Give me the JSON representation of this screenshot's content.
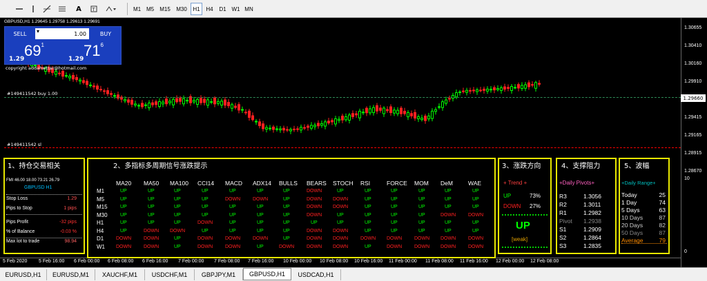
{
  "toolbar": {
    "tools": [
      "line-icon",
      "vertical-line-icon",
      "crosshair-icon",
      "trendline-icon",
      "text-icon",
      "label-icon",
      "arrows-icon"
    ],
    "text_tool": "A",
    "timeframes": [
      "M1",
      "M5",
      "M15",
      "M30",
      "H1",
      "H4",
      "D1",
      "W1",
      "MN"
    ],
    "active_timeframe": "H1"
  },
  "chart": {
    "symbol_line": "GBPUSD,H1  1.29645 1.29758 1.29613 1.29691",
    "copyright": "copyright  addahwttar@hotmail.com",
    "order_line_label": "#149411542 buy 1.00",
    "sl_line_label": "#149411542 sl",
    "current_price": "1.29691",
    "y_ticks": [
      "1.30655",
      "1.30410",
      "1.30160",
      "1.29910",
      "1.29660",
      "1.29415",
      "1.29165",
      "1.28915",
      "1.28670",
      "10",
      "0"
    ],
    "x_ticks": [
      "5 Feb 2020",
      "5 Feb 16:00",
      "6 Feb 00:00",
      "6 Feb 08:00",
      "6 Feb 16:00",
      "7 Feb 00:00",
      "7 Feb 08:00",
      "7 Feb 16:00",
      "10 Feb 00:00",
      "10 Feb 08:00",
      "10 Feb 16:00",
      "11 Feb 00:00",
      "11 Feb 08:00",
      "11 Feb 16:00",
      "12 Feb 00:00",
      "12 Feb 08:00"
    ],
    "colors": {
      "up": "#00ff00",
      "down": "#ff2020",
      "order_line": "#2e8b57",
      "sl_line": "#ff0000"
    }
  },
  "trade_panel": {
    "sell_label": "SELL",
    "buy_label": "BUY",
    "lot": "1.00",
    "sell_price_prefix": "1.29",
    "sell_price_big": "69",
    "sell_price_sup": "1",
    "buy_price_prefix": "1.29",
    "buy_price_big": "71",
    "buy_price_sup": "6"
  },
  "panel1": {
    "title": "1、持仓交易相关",
    "header": "FMI 46.00 18.00    73.21 26.79",
    "symbol": "GBPUSD  H1",
    "rows": [
      {
        "label": "Stop Loss",
        "value": "1.29"
      },
      {
        "label": "Pips to Stop",
        "value": "1 pips"
      },
      {
        "label": "Pips Profit",
        "value": "-32 pips"
      },
      {
        "label": "% of Balance",
        "value": "-0.03 %"
      },
      {
        "label": "Max lot to trade",
        "value": "98.94"
      }
    ]
  },
  "panel2": {
    "title": "2、多指标多周期信号涨跌提示",
    "columns": [
      "MA20",
      "MA50",
      "MA100",
      "CCI14",
      "MACD",
      "ADX14",
      "BULLS",
      "BEARS",
      "STOCH",
      "RSI",
      "FORCE",
      "MOM",
      "DeM",
      "WAE"
    ],
    "rows": [
      {
        "tf": "M1",
        "cells": [
          "UP",
          "UP",
          "UP",
          "UP",
          "UP",
          "UP",
          "UP",
          "DOWN",
          "UP",
          "UP",
          "UP",
          "UP",
          "UP",
          "UP"
        ]
      },
      {
        "tf": "M5",
        "cells": [
          "UP",
          "UP",
          "UP",
          "UP",
          "DOWN",
          "DOWN",
          "UP",
          "DOWN",
          "DOWN",
          "UP",
          "UP",
          "UP",
          "UP",
          "UP"
        ]
      },
      {
        "tf": "M15",
        "cells": [
          "UP",
          "UP",
          "UP",
          "UP",
          "UP",
          "UP",
          "UP",
          "DOWN",
          "DOWN",
          "UP",
          "UP",
          "UP",
          "UP",
          "UP"
        ]
      },
      {
        "tf": "M30",
        "cells": [
          "UP",
          "UP",
          "UP",
          "UP",
          "UP",
          "UP",
          "UP",
          "DOWN",
          "UP",
          "UP",
          "UP",
          "UP",
          "DOWN",
          "DOWN"
        ]
      },
      {
        "tf": "H1",
        "cells": [
          "UP",
          "UP",
          "UP",
          "DOWN",
          "UP",
          "UP",
          "UP",
          "UP",
          "UP",
          "UP",
          "UP",
          "UP",
          "UP",
          "UP"
        ]
      },
      {
        "tf": "H4",
        "cells": [
          "UP",
          "DOWN",
          "DOWN",
          "UP",
          "UP",
          "UP",
          "UP",
          "DOWN",
          "DOWN",
          "UP",
          "UP",
          "UP",
          "UP",
          "UP"
        ]
      },
      {
        "tf": "D1",
        "cells": [
          "DOWN",
          "DOWN",
          "UP",
          "DOWN",
          "DOWN",
          "DOWN",
          "UP",
          "DOWN",
          "DOWN",
          "DOWN",
          "DOWN",
          "DOWN",
          "DOWN",
          "DOWN"
        ]
      },
      {
        "tf": "W1",
        "cells": [
          "DOWN",
          "DOWN",
          "UP",
          "DOWN",
          "DOWN",
          "UP",
          "DOWN",
          "DOWN",
          "DOWN",
          "UP",
          "DOWN",
          "DOWN",
          "DOWN",
          "DOWN"
        ]
      }
    ]
  },
  "panel3": {
    "title": "3、涨跌方向",
    "header": "+  Trend  +",
    "up_label": "UP",
    "up_value": "73%",
    "down_label": "DOWN",
    "down_value": "27%",
    "signal": "UP",
    "strength": "[weak]"
  },
  "panel4": {
    "title": "4、支撑阻力",
    "header": "+Daily Pivots+",
    "rows": [
      {
        "label": "R3",
        "value": "1.3056"
      },
      {
        "label": "R2",
        "value": "1.3011"
      },
      {
        "label": "R1",
        "value": "1.2982"
      },
      {
        "label": "Pivot",
        "value": "1.2938"
      },
      {
        "label": "S1",
        "value": "1.2909"
      },
      {
        "label": "S2",
        "value": "1.2864"
      },
      {
        "label": "S3",
        "value": "1.2835"
      }
    ]
  },
  "panel5": {
    "title": "5、波幅",
    "header": "+Daily Range+",
    "rows": [
      {
        "label": "Today",
        "value": "25"
      },
      {
        "label": "1 Day",
        "value": "74"
      },
      {
        "label": "5 Days",
        "value": "63"
      },
      {
        "label": "10 Days",
        "value": "87"
      },
      {
        "label": "20 Days",
        "value": "82"
      },
      {
        "label": "50 Days",
        "value": "87"
      },
      {
        "label": "Average",
        "value": "79"
      }
    ]
  },
  "tabs": [
    "EURUSD,H1",
    "EURUSD,M1",
    "XAUCHF,M1",
    "USDCHF,M1",
    "GBPJPY,M1",
    "GBPUSD,H1",
    "USDCAD,H1"
  ],
  "active_tab": "GBPUSD,H1"
}
